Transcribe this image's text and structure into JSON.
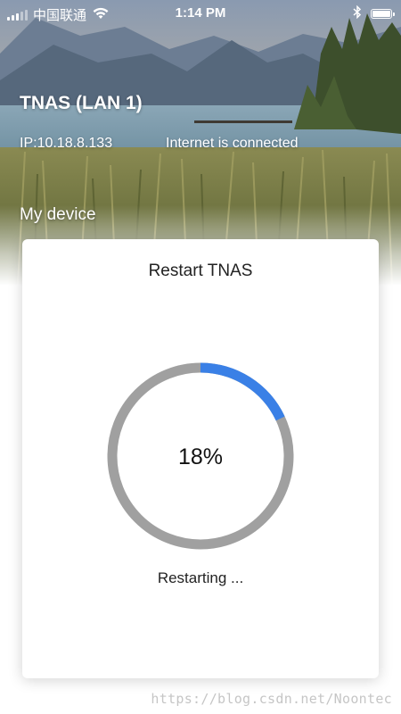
{
  "status_bar": {
    "carrier": "中国联通",
    "time": "1:14 PM",
    "icons": [
      "signal-icon",
      "wifi-icon",
      "bluetooth-icon",
      "battery-icon"
    ]
  },
  "header": {
    "device_name": "TNAS (LAN 1)",
    "ip": "IP:10.18.8.133",
    "internet_status": "Internet is connected",
    "section": "My device"
  },
  "dialog": {
    "title": "Restart TNAS",
    "progress": {
      "value": 18,
      "label": "18%",
      "color_active": "#3a80e6",
      "color_track": "#a0a0a0"
    },
    "status": "Restarting ..."
  },
  "watermark": "https://blog.csdn.net/Noontec"
}
